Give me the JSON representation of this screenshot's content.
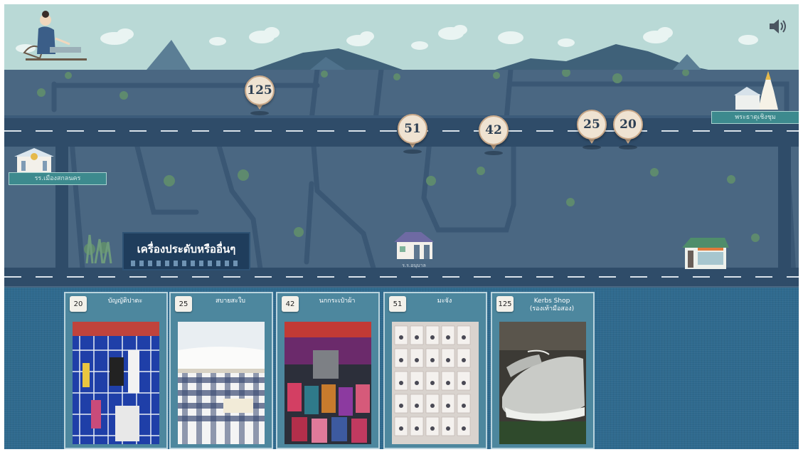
{
  "sound_icon": "speaker-icon",
  "title_banner": "เครื่องประดับหรืออื่นๆ",
  "landmarks": {
    "left_building": "รร.เมืองสกลนคร",
    "right_temple": "พระธาตุเชิงชุม",
    "clinic": "ร.ร.อนุบาล"
  },
  "pins": [
    "125",
    "51",
    "42",
    "25",
    "20"
  ],
  "shops": [
    {
      "number": "20",
      "name": "บัญญัติปาตะ"
    },
    {
      "number": "25",
      "name": "สบายสะใบ"
    },
    {
      "number": "42",
      "name": "นกกระเป๋าผ้า"
    },
    {
      "number": "51",
      "name": "มะจัง"
    },
    {
      "number": "125",
      "name": "Kerbs Shop\n(รองเท้ามือสอง)"
    }
  ]
}
